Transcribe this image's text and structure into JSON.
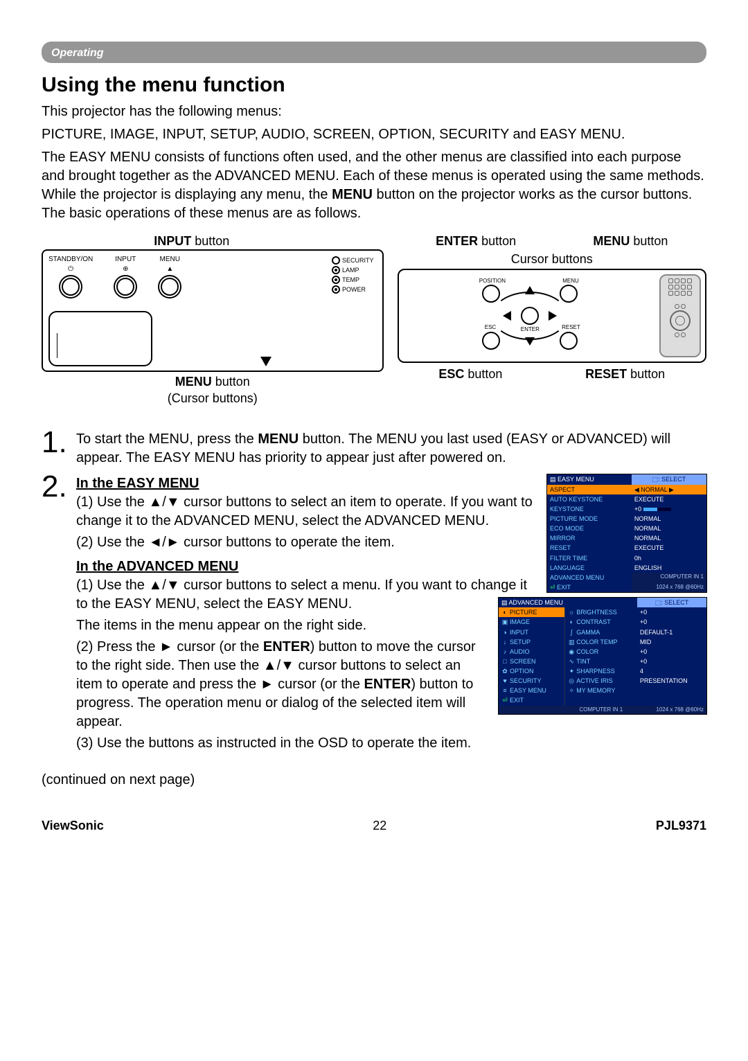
{
  "headline": "Operating",
  "title": "Using the menu function",
  "intro1": "This projector has the following menus:",
  "intro2": "PICTURE, IMAGE, INPUT, SETUP, AUDIO, SCREEN, OPTION, SECURITY and EASY MENU.",
  "intro3_a": "The EASY MENU consists of functions often used, and the other menus are classified into each purpose and brought together as the ADVANCED MENU. Each of these menus is operated using the same methods. While the projector is displaying any menu, the ",
  "intro3_bold": "MENU",
  "intro3_b": " button on the projector works as the cursor buttons. The basic operations of these menus are as follows.",
  "diag_left": {
    "top_label_bold": "INPUT",
    "top_label_rest": " button",
    "panel": {
      "btn1": "STANDBY/ON",
      "btn1_sym": "⏻",
      "btn2": "INPUT",
      "btn2_sym": "⊕",
      "btn3": "MENU",
      "btn3_sym": "▲",
      "led1": "SECURITY",
      "led2": "LAMP",
      "led3": "TEMP",
      "led4": "POWER"
    },
    "below_bold": "MENU",
    "below_rest": " button",
    "below_sub": "(Cursor buttons)"
  },
  "diag_right": {
    "top_left_bold": "ENTER",
    "top_left_rest": " button",
    "top_right_bold": "MENU",
    "top_right_rest": " button",
    "cursor_label": "Cursor buttons",
    "dpad": {
      "tl": "POSITION",
      "tr": "MENU",
      "ctr": "ENTER",
      "bl": "ESC",
      "br": "RESET"
    },
    "below_left_bold": "ESC",
    "below_left_rest": " button",
    "below_right_bold": "RESET",
    "below_right_rest": " button"
  },
  "steps": {
    "s1": {
      "num": "1.",
      "a": "To start the MENU, press the ",
      "bold1": "MENU",
      "b": " button. The MENU you last used (EASY or ADVANCED) will appear. The EASY MENU has priority to appear just after powered on."
    },
    "s2": {
      "num": "2.",
      "easy_title": "In the EASY MENU",
      "easy_1": "(1) Use the ▲/▼ cursor buttons to select an item to operate. If you want to change it to the ADVANCED MENU, select the ADVANCED MENU.",
      "easy_2": "(2) Use the ◄/► cursor buttons to operate the item.",
      "adv_title": "In the ADVANCED MENU",
      "adv_1": "(1) Use the ▲/▼ cursor buttons to select a menu. If you want to change it to the EASY MENU, select the EASY MENU.",
      "adv_1b": "The items in the menu appear on the right side.",
      "adv_2a": "(2) Press the ► cursor (or the ",
      "adv_2bold1": "ENTER",
      "adv_2b": ") button to move the cursor to the right side. Then use the ▲/▼ cursor buttons to select an item to operate and press the ► cursor (or the ",
      "adv_2bold2": "ENTER",
      "adv_2c": ") button to progress. The operation menu or dialog of the selected item will appear.",
      "adv_3": "(3) Use the buttons as instructed in the OSD to operate the item."
    }
  },
  "osd_easy": {
    "header_l": "EASY MENU",
    "header_r": "⬚: SELECT",
    "rows": [
      {
        "k": "ASPECT",
        "v": "NORMAL",
        "sel": true,
        "arrow": true
      },
      {
        "k": "AUTO KEYSTONE",
        "v": "EXECUTE"
      },
      {
        "k": "KEYSTONE",
        "v": "+0",
        "bar": true
      },
      {
        "k": "PICTURE MODE",
        "v": "NORMAL"
      },
      {
        "k": "ECO MODE",
        "v": "NORMAL"
      },
      {
        "k": "MIRROR",
        "v": "NORMAL"
      },
      {
        "k": "RESET",
        "v": "EXECUTE"
      },
      {
        "k": "FILTER TIME",
        "v": "0h"
      },
      {
        "k": "LANGUAGE",
        "v": "ENGLISH"
      },
      {
        "k": "ADVANCED MENU",
        "v": "COMPUTER IN 1",
        "foot": true
      },
      {
        "k": "EXIT",
        "v": "1024 x 768 @60Hz",
        "foot": true,
        "exit": true
      }
    ]
  },
  "osd_adv": {
    "header_l": "ADVANCED MENU",
    "header_r": "⬚: SELECT",
    "left": [
      {
        "ico": "◐",
        "k": "PICTURE",
        "sel": true
      },
      {
        "ico": "▣",
        "k": "IMAGE"
      },
      {
        "ico": "◑",
        "k": "INPUT"
      },
      {
        "ico": "↓",
        "k": "SETUP"
      },
      {
        "ico": "♪",
        "k": "AUDIO"
      },
      {
        "ico": "□",
        "k": "SCREEN"
      },
      {
        "ico": "✿",
        "k": "OPTION"
      },
      {
        "ico": "♥",
        "k": "SECURITY"
      },
      {
        "ico": "≡",
        "k": "EASY MENU"
      },
      {
        "ico": "⏎",
        "k": "EXIT",
        "exit": true
      }
    ],
    "right": [
      {
        "ico": "☼",
        "k": "BRIGHTNESS",
        "v": "+0"
      },
      {
        "ico": "◐",
        "k": "CONTRAST",
        "v": "+0"
      },
      {
        "ico": "∫",
        "k": "GAMMA",
        "v": "DEFAULT-1"
      },
      {
        "ico": "▥",
        "k": "COLOR TEMP",
        "v": "MID"
      },
      {
        "ico": "◉",
        "k": "COLOR",
        "v": "+0"
      },
      {
        "ico": "∿",
        "k": "TINT",
        "v": "+0"
      },
      {
        "ico": "✦",
        "k": "SHARPNESS",
        "v": "4"
      },
      {
        "ico": "◎",
        "k": "ACTIVE IRIS",
        "v": "PRESENTATION"
      },
      {
        "ico": "✧",
        "k": "MY MEMORY",
        "v": ""
      }
    ],
    "foot_l": "COMPUTER IN 1",
    "foot_r": "1024 x 768 @60Hz"
  },
  "continued": "(continued on next page)",
  "footer": {
    "l": "ViewSonic",
    "c": "22",
    "r": "PJL9371"
  }
}
